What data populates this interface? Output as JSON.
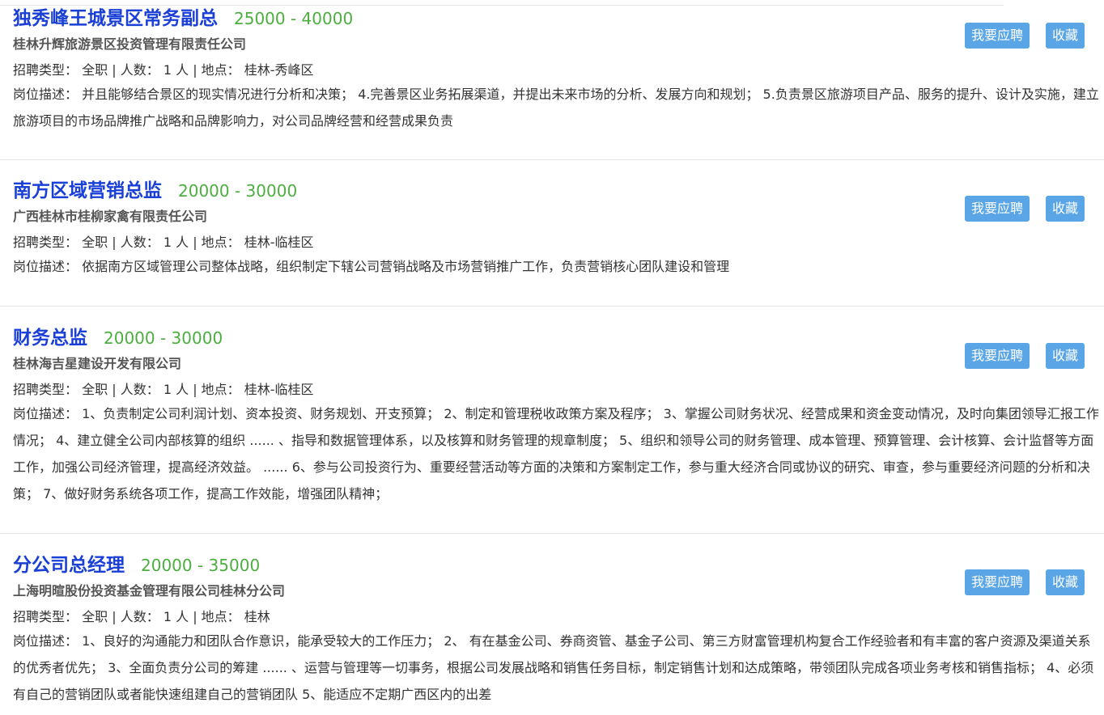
{
  "labels": {
    "type_prefix": "招聘类型：",
    "count_prefix": "人数：",
    "location_prefix": "地点：",
    "separator": "|",
    "desc_prefix": "岗位描述：",
    "apply_button": "我要应聘",
    "save_button": "收藏"
  },
  "jobs": [
    {
      "title": "独秀峰王城景区常务副总",
      "salary": "25000 - 40000",
      "company": "桂林升辉旅游景区投资管理有限责任公司",
      "type": "全职",
      "count": "1 人",
      "location": "桂林-秀峰区",
      "description": "并且能够结合景区的现实情况进行分析和决策； 4.完善景区业务拓展渠道，并提出未来市场的分析、发展方向和规划； 5.负责景区旅游项目产品、服务的提升、设计及实施，建立旅游项目的市场品牌推广战略和品牌影响力，对公司品牌经营和经营成果负责"
    },
    {
      "title": "南方区域营销总监",
      "salary": "20000 - 30000",
      "company": "广西桂林市桂柳家禽有限责任公司",
      "type": "全职",
      "count": "1 人",
      "location": "桂林-临桂区",
      "description": "依据南方区域管理公司整体战略，组织制定下辖公司营销战略及市场营销推广工作，负责营销核心团队建设和管理"
    },
    {
      "title": "财务总监",
      "salary": "20000 - 30000",
      "company": "桂林海吉星建设开发有限公司",
      "type": "全职",
      "count": "1 人",
      "location": "桂林-临桂区",
      "description": "1、负责制定公司利润计划、资本投资、财务规划、开支预算； 2、制定和管理税收政策方案及程序； 3、掌握公司财务状况、经营成果和资金变动情况，及时向集团领导汇报工作情况； 4、建立健全公司内部核算的组织 ...... 、指导和数据管理体系，以及核算和财务管理的规章制度； 5、组织和领导公司的财务管理、成本管理、预算管理、会计核算、会计监督等方面工作，加强公司经济管理，提高经济效益。 ...... 6、参与公司投资行为、重要经营活动等方面的决策和方案制定工作，参与重大经济合同或协议的研究、审查，参与重要经济问题的分析和决策； 7、做好财务系统各项工作，提高工作效能，增强团队精神；"
    },
    {
      "title": "分公司总经理",
      "salary": "20000 - 35000",
      "company": "上海明暄股份投资基金管理有限公司桂林分公司",
      "type": "全职",
      "count": "1 人",
      "location": "桂林",
      "description": "1、良好的沟通能力和团队合作意识，能承受较大的工作压力； 2、 有在基金公司、券商资管、基金子公司、第三方财富管理机构复合工作经验者和有丰富的客户资源及渠道关系的优秀者优先； 3、全面负责分公司的筹建 ...... 、运营与管理等一切事务，根据公司发展战略和销售任务目标，制定销售计划和达成策略，带领团队完成各项业务考核和销售指标； 4、必须有自己的营销团队或者能快速组建自己的营销团队 5、能适应不定期广西区内的出差"
    }
  ]
}
